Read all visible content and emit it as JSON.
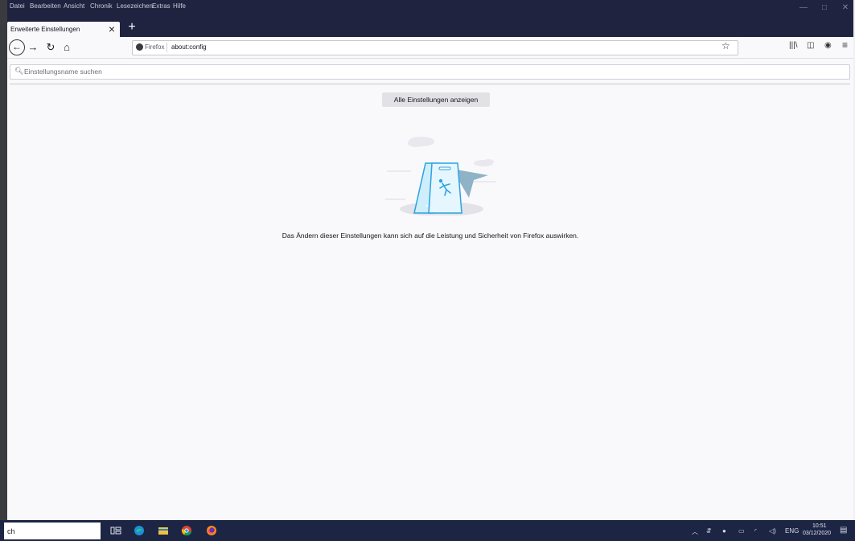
{
  "menubar": {
    "items": [
      "Datei",
      "Bearbeiten",
      "Ansicht",
      "Chronik",
      "Lesezeichen",
      "Extras",
      "Hilfe"
    ],
    "minimize": "—",
    "maximize": "□",
    "close": "✕"
  },
  "tabs": {
    "active_title": "Erweiterte Einstellungen",
    "close_glyph": "×",
    "new_tab_glyph": "+"
  },
  "navbar": {
    "back": "←",
    "forward": "→",
    "reload": "↻",
    "home": "⌂",
    "identity": "Firefox",
    "url": "about:config",
    "bookmark": "☆"
  },
  "toolbar_right": {
    "library": "|||\\",
    "sidebar": "◫",
    "account": "◉",
    "menu": "≡"
  },
  "content": {
    "search_placeholder": "Einstellungsname suchen",
    "show_all_label": "Alle Einstellungen anzeigen",
    "warning_text": "Das Ändern dieser Einstellungen kann sich auf die Leistung und Sicherheit von Firefox auswirken."
  },
  "taskbar": {
    "search_text": "ch",
    "tray_language": "ENG",
    "clock_time": "10:51",
    "clock_date": "03/12/2020"
  },
  "colors": {
    "chrome": "#202340",
    "content_bg": "#f9f9fb",
    "taskbar": "#1c2544",
    "illustration_blue": "#29a3e1"
  }
}
